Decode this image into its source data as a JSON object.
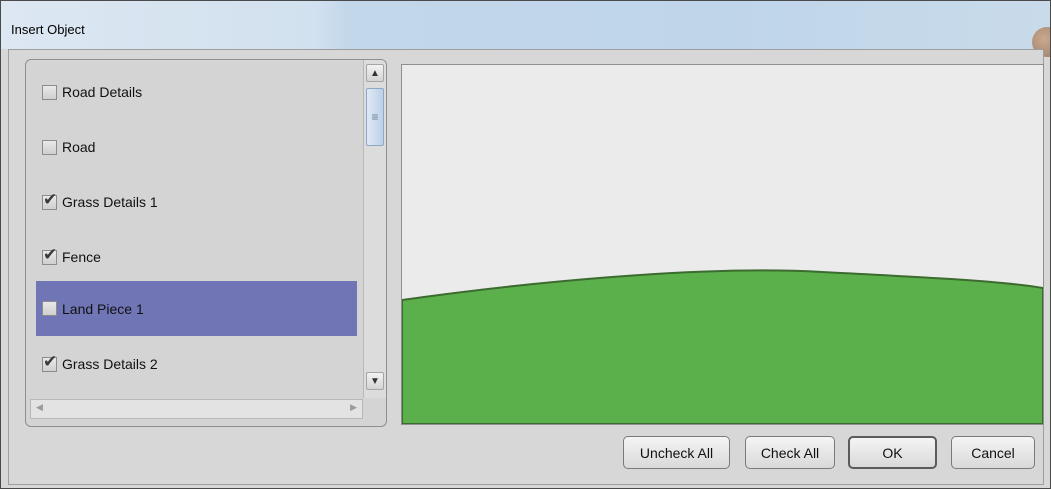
{
  "window": {
    "title": "Insert Object"
  },
  "list": {
    "items": [
      {
        "label": "Road Details",
        "checked": false,
        "selected": false
      },
      {
        "label": "Road",
        "checked": false,
        "selected": false
      },
      {
        "label": "Grass Details 1",
        "checked": true,
        "selected": false
      },
      {
        "label": "Fence",
        "checked": true,
        "selected": false
      },
      {
        "label": "Land Piece 1",
        "checked": false,
        "selected": true
      },
      {
        "label": "Grass Details 2",
        "checked": true,
        "selected": false
      }
    ],
    "check_glyph": "✔"
  },
  "scrollbar": {
    "up_glyph": "▲",
    "down_glyph": "▼",
    "left_glyph": "◀",
    "right_glyph": "▶",
    "thumb_glyph": "≡"
  },
  "preview": {
    "sky_color": "#ebebeb",
    "land_color": "#5cb04c",
    "outline_color": "#3b6b2e"
  },
  "buttons": {
    "uncheck_all": "Uncheck All",
    "check_all": "Check All",
    "ok": "OK",
    "cancel": "Cancel"
  },
  "colors": {
    "selection": "#7075b6",
    "dialog_bg": "#d7d7d7"
  }
}
